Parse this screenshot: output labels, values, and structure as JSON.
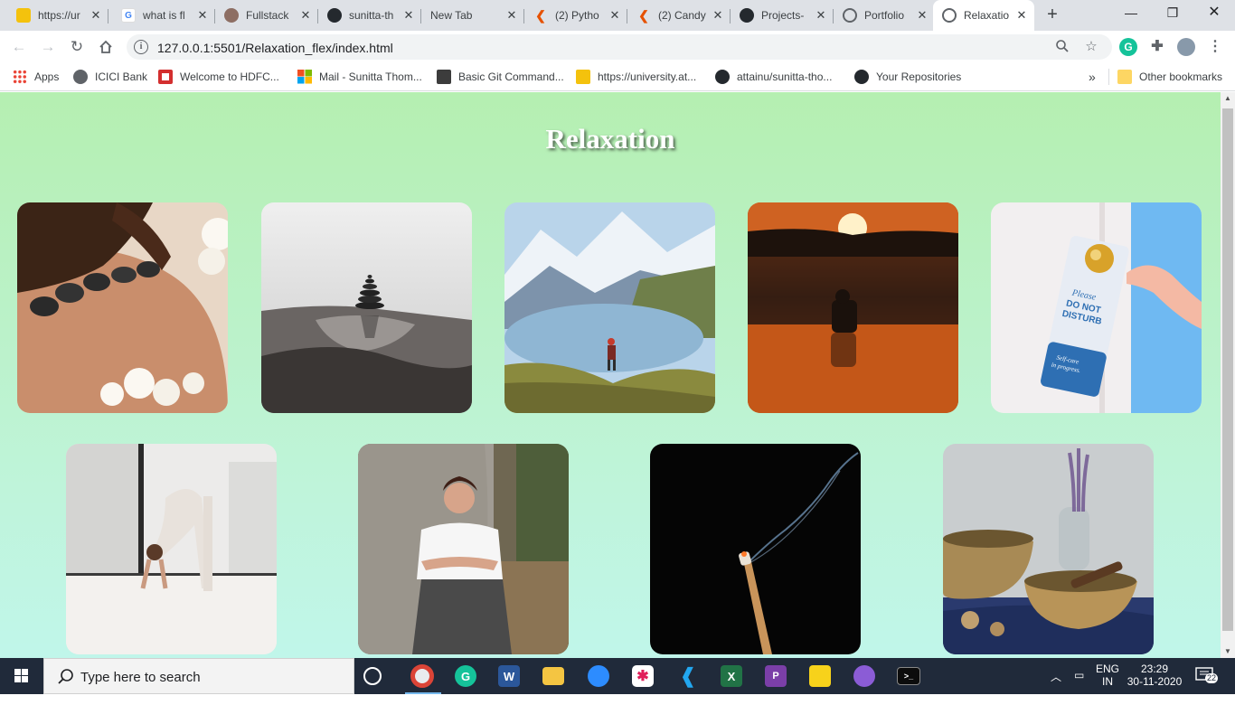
{
  "browser": {
    "tabs": [
      {
        "title": "https://ur",
        "icon": "sticky-note-icon",
        "color": "#f4c20d"
      },
      {
        "title": "what is fl",
        "icon": "google-icon",
        "color": "#4285f4"
      },
      {
        "title": "Fullstack",
        "icon": "fullstack-icon",
        "color": "#8d6e63"
      },
      {
        "title": "sunitta-th",
        "icon": "github-icon",
        "color": "#24292e"
      },
      {
        "title": "New Tab",
        "icon": "",
        "color": ""
      },
      {
        "title": "(2) Pytho",
        "icon": "candy-icon",
        "color": "#e65100"
      },
      {
        "title": "(2) Candy",
        "icon": "candy-icon",
        "color": "#e65100"
      },
      {
        "title": "Projects-",
        "icon": "github-icon",
        "color": "#24292e"
      },
      {
        "title": "Portfolio",
        "icon": "globe-icon",
        "color": "#5f6368"
      },
      {
        "title": "Relaxatio",
        "icon": "globe-icon",
        "color": "#5f6368"
      }
    ],
    "address_url": "127.0.0.1:5501/Relaxation_flex/index.html",
    "bookmarks": [
      {
        "label": "Apps",
        "icon": "apps-grid-icon"
      },
      {
        "label": "ICICI Bank",
        "icon": "globe-icon"
      },
      {
        "label": "Welcome to HDFC...",
        "icon": "hdfc-icon"
      },
      {
        "label": "Mail - Sunitta Thom...",
        "icon": "microsoft-icon"
      },
      {
        "label": "Basic Git Command...",
        "icon": "git-icon"
      },
      {
        "label": "https://university.at...",
        "icon": "sticky-note-icon"
      },
      {
        "label": "attainu/sunitta-tho...",
        "icon": "github-icon"
      },
      {
        "label": "Your Repositories",
        "icon": "github-icon"
      }
    ],
    "more_bookmarks": "»",
    "other_bookmarks": "Other bookmarks"
  },
  "page": {
    "title": "Relaxation",
    "images": [
      {
        "name": "massage-image",
        "subject": "hot stone massage"
      },
      {
        "name": "stone-stack-image",
        "subject": "stacked stones"
      },
      {
        "name": "mountain-lake-image",
        "subject": "hiker at mountain lake"
      },
      {
        "name": "sunset-image",
        "subject": "person at sunset"
      },
      {
        "name": "do-not-disturb-image",
        "subject": "door hanger",
        "sign_lines": [
          "Please",
          "DO NOT",
          "DISTURB",
          "Self-care",
          "in progress."
        ]
      },
      {
        "name": "yoga-image",
        "subject": "yoga pose"
      },
      {
        "name": "woman-tree-image",
        "subject": "woman leaning on tree"
      },
      {
        "name": "incense-image",
        "subject": "incense stick"
      },
      {
        "name": "singing-bowls-image",
        "subject": "singing bowls"
      }
    ]
  },
  "taskbar": {
    "search_placeholder": "Type here to search",
    "lang_primary": "ENG",
    "lang_secondary": "IN",
    "time": "23:29",
    "date": "30-11-2020",
    "notifications": "22"
  }
}
